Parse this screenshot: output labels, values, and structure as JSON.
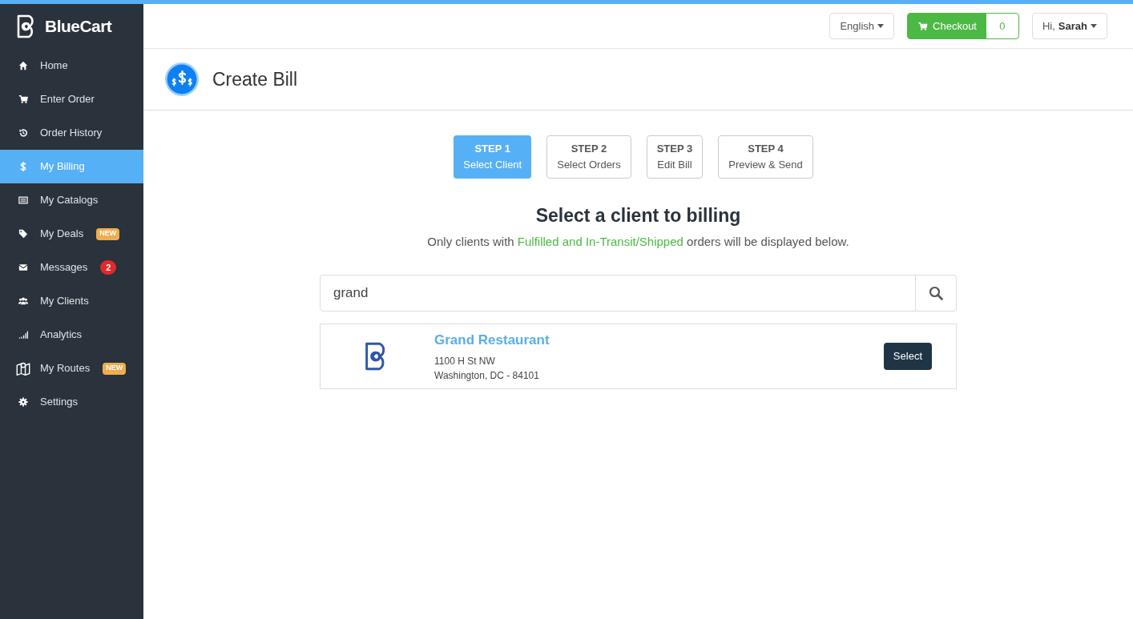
{
  "brand": "BlueCart",
  "sidebar": {
    "items": [
      {
        "label": "Home",
        "selected": false
      },
      {
        "label": "Enter Order",
        "selected": false
      },
      {
        "label": "Order History",
        "selected": false
      },
      {
        "label": "My Billing",
        "selected": true
      },
      {
        "label": "My Catalogs",
        "selected": false
      },
      {
        "label": "My Deals",
        "selected": false,
        "badge": {
          "text": "NEW",
          "kind": "new"
        }
      },
      {
        "label": "Messages",
        "selected": false,
        "badge": {
          "text": "2",
          "kind": "count"
        }
      },
      {
        "label": "My Clients",
        "selected": false
      },
      {
        "label": "Analytics",
        "selected": false
      },
      {
        "label": "My Routes",
        "selected": false,
        "badge": {
          "text": "NEW",
          "kind": "new"
        }
      },
      {
        "label": "Settings",
        "selected": false
      }
    ]
  },
  "topbar": {
    "language": "English",
    "checkout": {
      "label": "Checkout",
      "count": "0"
    },
    "greeting": "Hi,",
    "user": "Sarah"
  },
  "page_title": "Create Bill",
  "steps": [
    {
      "label": "STEP 1",
      "title": "Select Client",
      "selected": true
    },
    {
      "label": "STEP 2",
      "title": "Select Orders",
      "selected": false
    },
    {
      "label": "STEP 3",
      "title": "Edit Bill",
      "selected": false
    },
    {
      "label": "STEP 4",
      "title": "Preview & Send",
      "selected": false
    }
  ],
  "heading": "Select a client to billing",
  "subtitle": {
    "before": "Only clients with ",
    "highlight": "Fulfilled and In-Transit/Shipped",
    "after": " orders will be displayed below."
  },
  "search": {
    "value": "grand"
  },
  "results": [
    {
      "name": "Grand Restaurant",
      "address": "1100 H St NW",
      "city": "Washington, DC - 84101",
      "button": "Select"
    }
  ]
}
